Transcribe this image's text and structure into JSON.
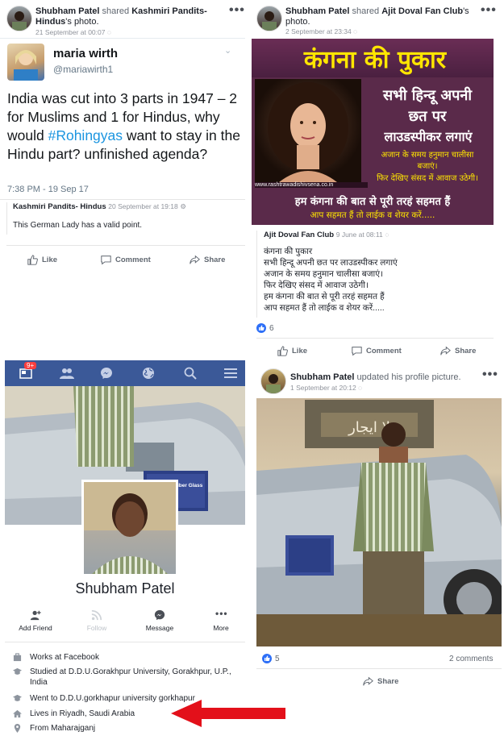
{
  "post1": {
    "author": "Shubham Patel",
    "action": "shared",
    "source": "Kashmiri Pandits-Hindus",
    "source_suffix": "'s photo.",
    "timestamp": "21 September at 00:07",
    "tweet": {
      "display_name": "maria wirth",
      "handle": "@mariawirth1",
      "text": "India was cut into 3 parts in 1947 – 2 for Muslims and 1 for Hindus, why would ",
      "hashtag": "#Rohingyas",
      "text_after": " want to stay in the Hindu part? unfinished agenda?",
      "time": "7:38 PM - 19 Sep 17"
    },
    "comment": {
      "author": "Kashmiri Pandits- Hindus",
      "time": "20 September at 19:18",
      "text": "This German Lady has a valid point."
    },
    "actions": {
      "like": "Like",
      "comment": "Comment",
      "share": "Share"
    }
  },
  "post2": {
    "author": "Shubham Patel",
    "action": "shared",
    "source": "Ajit Doval Fan Club",
    "source_suffix": "'s photo.",
    "timestamp": "2 September at 23:34",
    "poster": {
      "title": "कंगना की पुकार",
      "line1": "सभी हिन्दू अपनी",
      "line2": "छत पर",
      "line3": "लाउडस्पीकर लगाएं",
      "line4": "अजान के समय हनुमान चालीसा",
      "line5": "बजाएं।",
      "line6": "फिर देखिए संसद में आवाज उठेगी।",
      "website": "www.rashtrawadishivsena.co.in",
      "bottom1": "हम कंगना की बात से पूरी तरहं सहमत हैं",
      "bottom2": "आप सहमत हैं तो लाईक व शेयर करें....."
    },
    "caption": {
      "author": "Ajit Doval Fan Club",
      "time": "9 June at 08:11",
      "lines": [
        "कंगना की पुकार",
        "सभी हिन्दू अपनी छत पर लाउडस्पीकर लगाएं",
        "अजान के समय हनुमान चालीसा बजाएं।",
        "फिर देखिए संसद में आवाज उठेगी।",
        "हम कंगना की बात से पूरी तरहं सहमत हैं",
        "आप सहमत हैं तो लाईक व शेयर करें....."
      ]
    },
    "likes": "6",
    "actions": {
      "like": "Like",
      "comment": "Comment",
      "share": "Share"
    }
  },
  "post3": {
    "author": "Shubham Patel",
    "action": "updated his profile picture.",
    "timestamp": "1 September at 20:12",
    "likes": "5",
    "comments": "2 comments",
    "actions": {
      "share": "Share"
    }
  },
  "profile": {
    "notification_badge": "9+",
    "name": "Shubham Patel",
    "buttons": {
      "add_friend": "Add Friend",
      "follow": "Follow",
      "message": "Message",
      "more": "More"
    },
    "info": {
      "work": "Works at Facebook",
      "studied": "Studied at D.D.U.Gorakhpur University, Gorakhpur, U.P., India",
      "went": "Went to D.D.U.gorkhapur university gorkhapur",
      "lives": "Lives in Riyadh, Saudi Arabia",
      "from": "From Maharajganj"
    },
    "plate_text": "Saudi for Fiber Glass & Acrylic"
  },
  "colors": {
    "fb_blue": "#3b5998",
    "link_blue": "#385898",
    "poster_bg": "#5a2a4a",
    "poster_yellow": "#ffe600",
    "arrow_red": "#e3101a",
    "like_blue": "#2d6ff7"
  }
}
